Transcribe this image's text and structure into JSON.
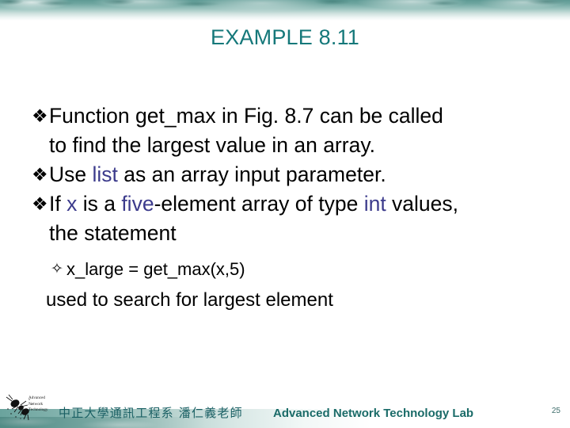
{
  "slide": {
    "title": "EXAMPLE 8.11",
    "page_number": "25",
    "colors": {
      "title_teal": "#15787a",
      "accent_blue": "#3c3b8c",
      "body_black": "#000000",
      "band_teal": "#6aa39d",
      "footer_teal": "#1a6b68"
    }
  },
  "bullets": [
    {
      "marker": "❖",
      "marker_name": "diamond-bullet",
      "segments": [
        {
          "text": "Function get_max in Fig. 8.7 can be called",
          "color": "black"
        }
      ],
      "continuation": "to find the largest value in an array."
    },
    {
      "marker": "❖",
      "marker_name": "diamond-bullet",
      "segments": [
        {
          "text": "Use ",
          "color": "black"
        },
        {
          "text": "list",
          "color": "accent"
        },
        {
          "text": " as an array input parameter.",
          "color": "black"
        }
      ],
      "continuation": ""
    },
    {
      "marker": "❖",
      "marker_name": "diamond-bullet",
      "segments": [
        {
          "text": "If ",
          "color": "black"
        },
        {
          "text": "x",
          "color": "accent"
        },
        {
          "text": " is a ",
          "color": "black"
        },
        {
          "text": "five",
          "color": "accent"
        },
        {
          "text": "-element array of type ",
          "color": "black"
        },
        {
          "text": "int",
          "color": "accent"
        },
        {
          "text": " values,",
          "color": "black"
        }
      ],
      "continuation": "the statement"
    }
  ],
  "sub_bullet": {
    "marker": "✧",
    "marker_name": "open-diamond-bullet",
    "text": "x_large = get_max(x,5)"
  },
  "closing_line": "used to search for largest element",
  "footer": {
    "logo_lines": [
      "Advanced",
      "Network",
      "Technology"
    ],
    "department_cn": "中正大學通訊工程系 潘仁義老師",
    "lab_name": "Advanced Network Technology Lab"
  }
}
